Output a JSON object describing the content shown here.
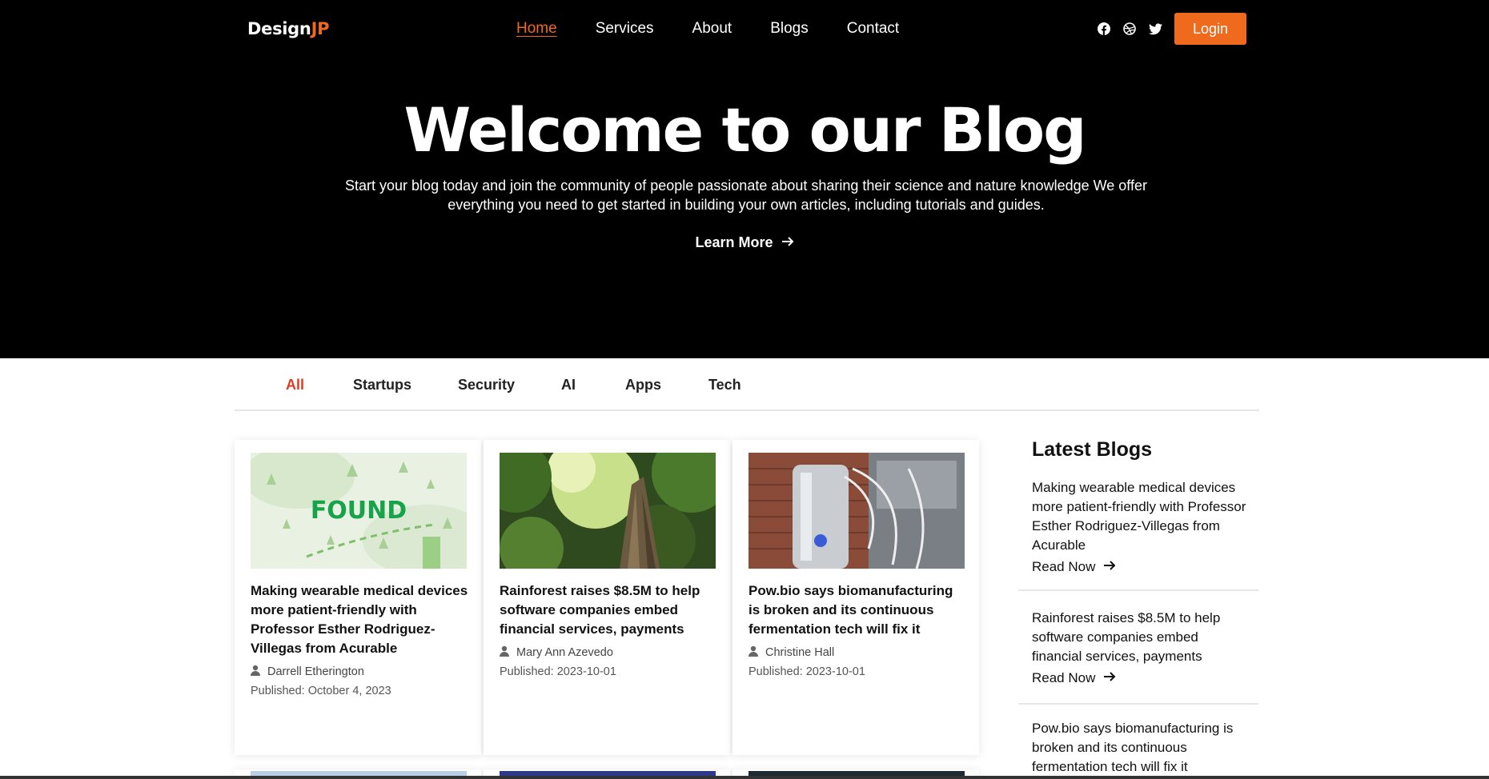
{
  "header": {
    "logo_main": "Design",
    "logo_accent": "JP",
    "nav": [
      "Home",
      "Services",
      "About",
      "Blogs",
      "Contact"
    ],
    "social_icons": [
      "facebook-icon",
      "dribbble-icon",
      "twitter-icon"
    ],
    "login_label": "Login",
    "accent_color": "#f06a1d"
  },
  "hero": {
    "title": "Welcome to our Blog",
    "subtitle": "Start your blog today and join the community of people passionate about sharing their science and nature knowledge We offer everything you need to get started in building your own articles, including tutorials and guides.",
    "cta_label": "Learn More"
  },
  "filters": {
    "tabs": [
      "All",
      "Startups",
      "Security",
      "AI",
      "Apps",
      "Tech"
    ],
    "active": "All"
  },
  "posts": [
    {
      "title": "Making wearable medical devices more patient-friendly with Professor Esther Rodriguez-Villegas from Acurable",
      "author": "Darrell Etherington",
      "published": "Published: October 4, 2023",
      "thumb_label": "FOUND"
    },
    {
      "title": "Rainforest raises $8.5M to help software companies embed financial services, payments",
      "author": "Mary Ann Azevedo",
      "published": "Published: 2023-10-01"
    },
    {
      "title": "Pow.bio says biomanufacturing is broken and its continuous fermentation tech will fix it",
      "author": "Christine Hall",
      "published": "Published: 2023-10-01"
    }
  ],
  "sidebar": {
    "heading": "Latest Blogs",
    "read_label": "Read Now",
    "items": [
      {
        "title": "Making wearable medical devices more patient-friendly with Professor Esther Rodriguez-Villegas from Acurable"
      },
      {
        "title": "Rainforest raises $8.5M to help software companies embed financial services, payments"
      },
      {
        "title": "Pow.bio says biomanufacturing is broken and its continuous fermentation tech will fix it"
      }
    ]
  }
}
